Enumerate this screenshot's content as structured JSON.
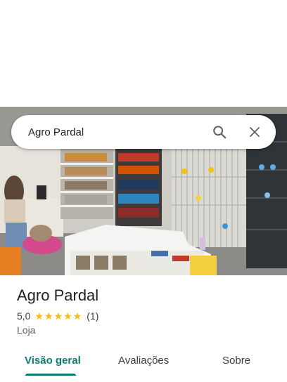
{
  "search": {
    "query": "Agro Pardal",
    "search_icon": "search-icon",
    "close_icon": "close-icon"
  },
  "place": {
    "name": "Agro Pardal",
    "rating_value": "5,0",
    "rating_stars": 5,
    "review_count": "(1)",
    "category": "Loja"
  },
  "tabs": [
    {
      "label": "Visão geral",
      "active": true
    },
    {
      "label": "Avaliações",
      "active": false
    },
    {
      "label": "Sobre",
      "active": false
    }
  ],
  "colors": {
    "accent": "#0b7a75",
    "star": "#fbbc04",
    "text_primary": "#202124",
    "text_secondary": "#5f6368"
  }
}
